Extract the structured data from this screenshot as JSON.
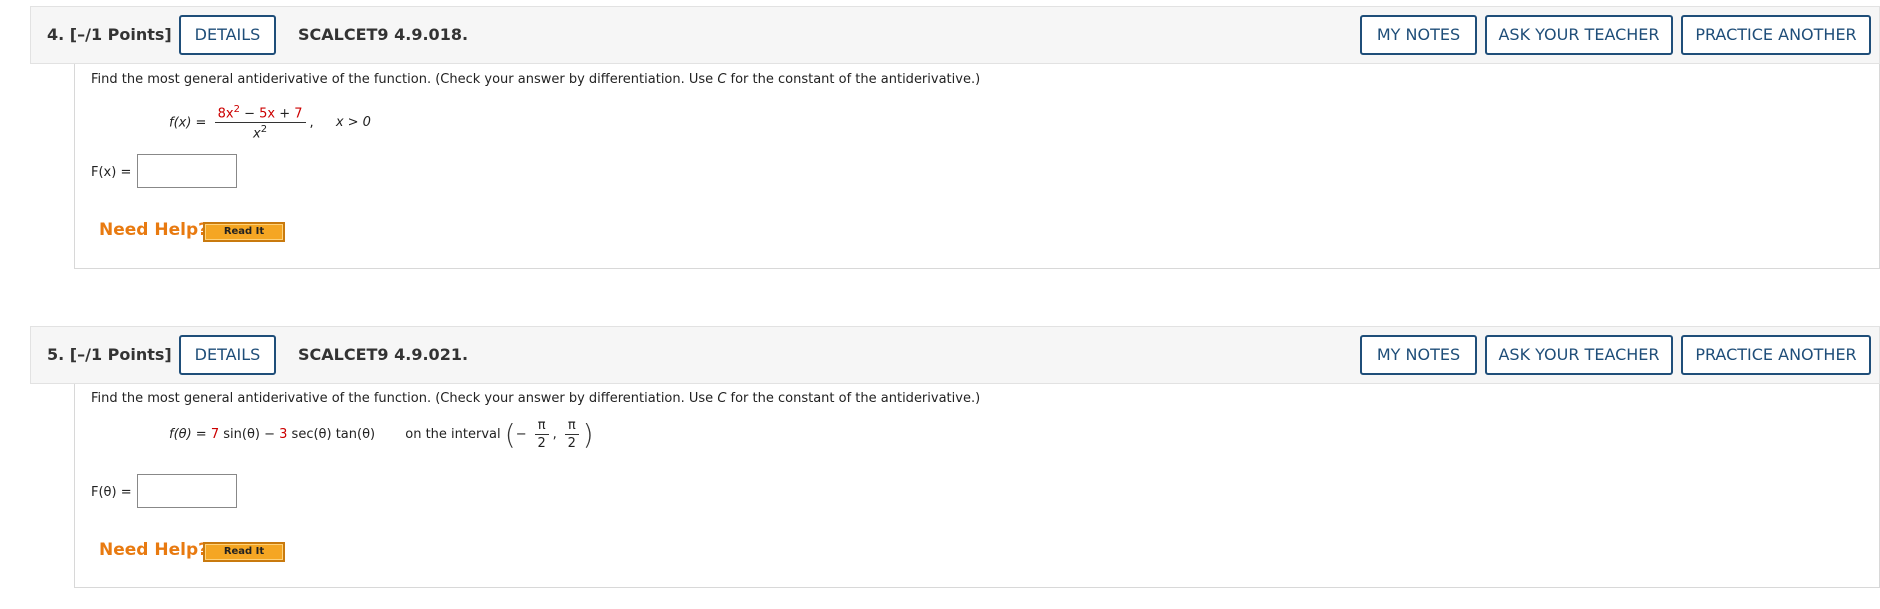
{
  "questions": [
    {
      "number": "4.",
      "points": "[–/1 Points]",
      "details_label": "DETAILS",
      "code": "SCALCET9 4.9.018.",
      "my_notes_label": "MY NOTES",
      "ask_teacher_label": "ASK YOUR TEACHER",
      "practice_label": "PRACTICE ANOTHER",
      "prompt_a": "Find the most general antiderivative of the function. (Check your answer by differentiation. Use ",
      "prompt_c": "C",
      "prompt_b": " for the constant of the antiderivative.)",
      "func_lhs": "f(x) =",
      "num_red1": "8x",
      "num_exp": "2",
      "num_mid": " − ",
      "num_red2": "5x",
      "num_plus": " + ",
      "num_red3": "7",
      "den": "x",
      "den_exp": "2",
      "comma": ",",
      "condition": "x > 0",
      "answer_label": "F(x) =",
      "answer_value": "",
      "need_help": "Need Help?",
      "read_it": "Read It"
    },
    {
      "number": "5.",
      "points": "[–/1 Points]",
      "details_label": "DETAILS",
      "code": "SCALCET9 4.9.021.",
      "my_notes_label": "MY NOTES",
      "ask_teacher_label": "ASK YOUR TEACHER",
      "practice_label": "PRACTICE ANOTHER",
      "prompt_a": "Find the most general antiderivative of the function. (Check your answer by differentiation. Use ",
      "prompt_c": "C",
      "prompt_b": " for the constant of the antiderivative.)",
      "func_lhs": "f(θ) = ",
      "coef1": "7",
      "term1": " sin(θ) − ",
      "coef2": "3",
      "term2": " sec(θ) tan(θ)",
      "interval_text": "on the interval",
      "minus": "−",
      "pi": "π",
      "two": "2",
      "comma": ",",
      "answer_label": "F(θ) =",
      "answer_value": "",
      "need_help": "Need Help?",
      "read_it": "Read It"
    }
  ]
}
